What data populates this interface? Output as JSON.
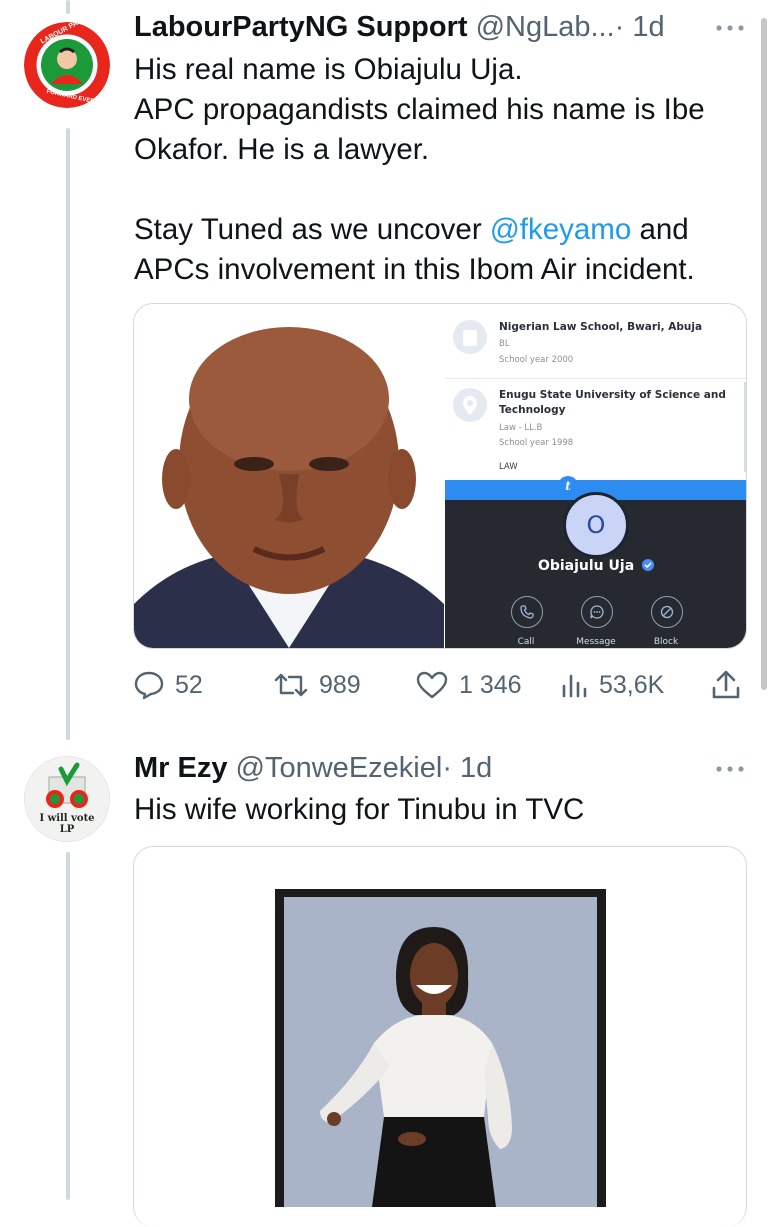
{
  "colors": {
    "accent": "#1d9bf0",
    "muted": "#536471",
    "thread_line": "#cfd9de"
  },
  "tweet1": {
    "display_name": "LabourPartyNG Support",
    "handle": "@NgLab...",
    "time": "· 1d",
    "text_before_mention": "His real name is Obiajulu Uja.\nAPC propagandists claimed his name is Ibe Okafor. He is a lawyer.\n\nStay Tuned as we uncover ",
    "mention": "@fkeyamo",
    "text_after_mention": " and APCs involvement in this Ibom Air incident.",
    "avatar": {
      "icon": "labour-party-logo",
      "ring_text_top": "LABOUR PARTY",
      "ring_text_bottom": "FORWARD EVER"
    },
    "profile_card": {
      "edu1_title": "Nigerian Law School, Bwari, Abuja",
      "edu1_degree": "BL",
      "edu1_year": "School year 2000",
      "edu2_title": "Enugu State University of Science and Technology",
      "edu2_degree": "Law - LL.B",
      "edu2_year": "School year 1998",
      "field": "LAW",
      "badge": "t",
      "avatar_letter": "O",
      "name": "Obiajulu Uja",
      "buttons": {
        "call": "Call",
        "message": "Message",
        "block": "Block"
      }
    },
    "stats": {
      "replies": "52",
      "retweets": "989",
      "likes": "1 346",
      "views": "53,6K"
    }
  },
  "tweet2": {
    "display_name": "Mr Ezy",
    "handle": "@TonweEzekiel",
    "time": "· 1d",
    "text": "His wife working for Tinubu in TVC",
    "avatar": {
      "icon": "i-will-vote-lp-logo",
      "text": "I will vote LP"
    }
  }
}
